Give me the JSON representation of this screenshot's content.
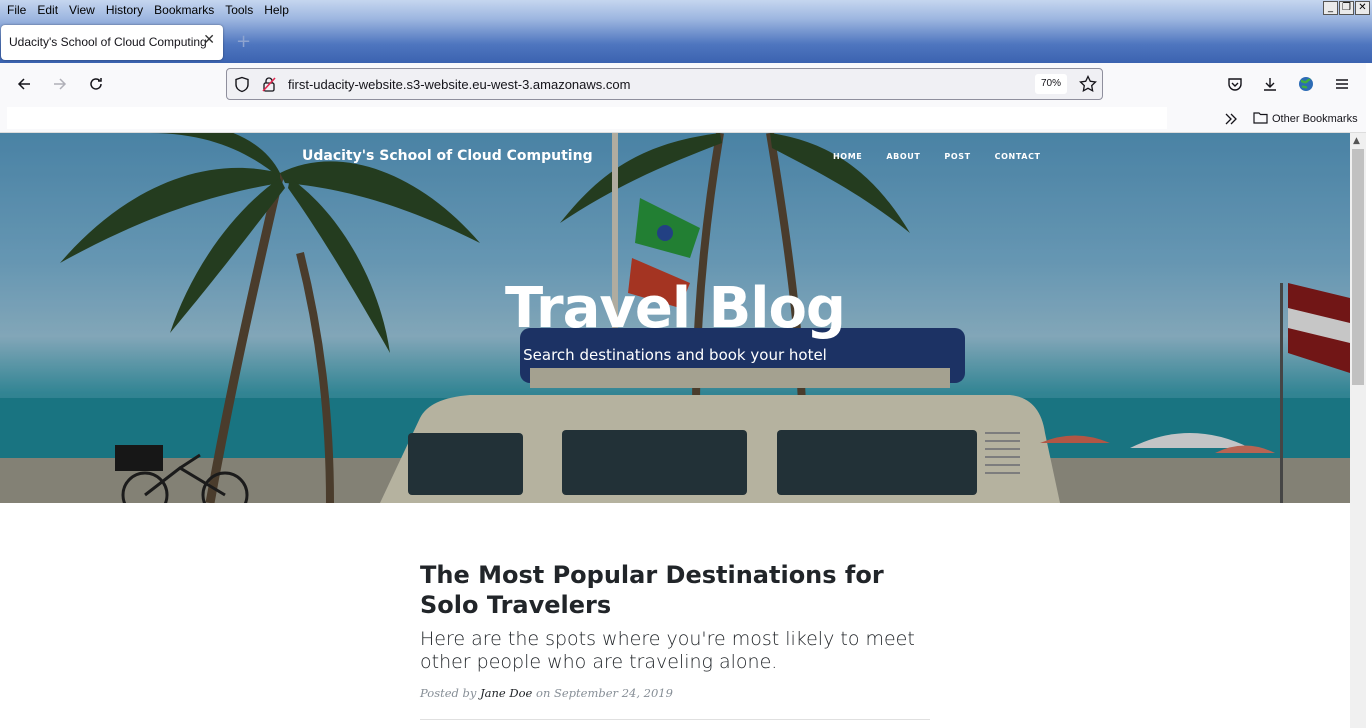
{
  "browser": {
    "menu": [
      "File",
      "Edit",
      "View",
      "History",
      "Bookmarks",
      "Tools",
      "Help"
    ],
    "window_controls": [
      "_",
      "❐",
      "✕"
    ],
    "tab": {
      "title": "Udacity's School of Cloud Computing",
      "close": "✕"
    },
    "new_tab": "+",
    "url": "first-udacity-website.s3-website.eu-west-3.amazonaws.com",
    "zoom": "70%",
    "other_bookmarks": "Other Bookmarks",
    "colors": {
      "toolbar": "#f9f9fb",
      "titlebar_accent": "#3b63b0"
    }
  },
  "site": {
    "brand": "Udacity's School of Cloud Computing",
    "nav": [
      "HOME",
      "ABOUT",
      "POST",
      "CONTACT"
    ],
    "hero": {
      "title": "Travel Blog",
      "subtitle": "Search destinations and book your hotel"
    },
    "post": {
      "title": "The Most Popular Destinations for Solo Travelers",
      "subtitle": "Here are the spots where you're most likely to meet other people who are traveling alone.",
      "meta_prefix": "Posted by ",
      "author": "Jane Doe",
      "meta_suffix": " on September 24, 2019"
    }
  }
}
